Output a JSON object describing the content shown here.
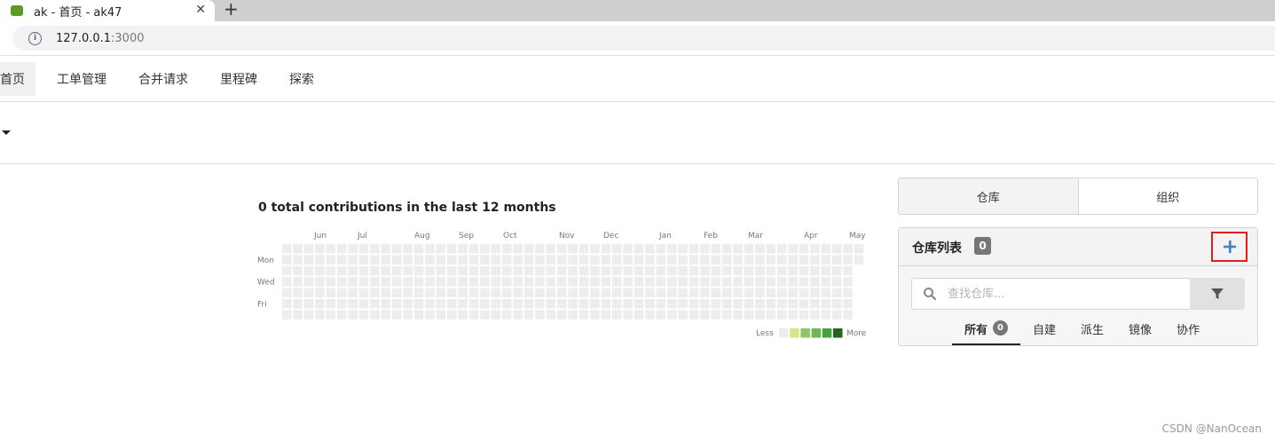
{
  "browser": {
    "tab_title": "ak - 首页 - ak47",
    "tab_close": "✕",
    "new_tab": "+",
    "url_host": "127.0.0.1",
    "url_port": ":3000"
  },
  "nav": {
    "items": [
      {
        "label": "首页",
        "active": true
      },
      {
        "label": "工单管理"
      },
      {
        "label": "合并请求"
      },
      {
        "label": "里程碑"
      },
      {
        "label": "探索"
      }
    ]
  },
  "heatmap": {
    "title": "0 total contributions in the last 12 months",
    "months": [
      "Jun",
      "Jul",
      "Aug",
      "Sep",
      "Oct",
      "Nov",
      "Dec",
      "Jan",
      "Feb",
      "Mar",
      "Apr",
      "May"
    ],
    "days": [
      "Mon",
      "Wed",
      "Fri"
    ],
    "legend_less": "Less",
    "legend_more": "More",
    "legend_colors": [
      "#ebedf0",
      "#d6e685",
      "#8cc665",
      "#6db852",
      "#44a340",
      "#1e6823"
    ],
    "empty_color": "#ededed"
  },
  "chart_data": {
    "type": "heatmap",
    "title": "0 total contributions in the last 12 months",
    "x": [
      "Jun",
      "Jul",
      "Aug",
      "Sep",
      "Oct",
      "Nov",
      "Dec",
      "Jan",
      "Feb",
      "Mar",
      "Apr",
      "May"
    ],
    "y": [
      "Mon",
      "Wed",
      "Fri"
    ],
    "total": 0,
    "values": []
  },
  "panel": {
    "tabs": [
      {
        "label": "仓库",
        "active": true
      },
      {
        "label": "组织"
      }
    ],
    "repo_list_title": "仓库列表",
    "repo_count": "0",
    "add_label": "+",
    "search_placeholder": "查找仓库...",
    "filters": [
      {
        "label": "所有",
        "badge": "0",
        "active": true
      },
      {
        "label": "自建"
      },
      {
        "label": "派生"
      },
      {
        "label": "镜像"
      },
      {
        "label": "协作"
      }
    ],
    "accent": "#4183c4"
  },
  "watermark": "CSDN @NanOcean"
}
